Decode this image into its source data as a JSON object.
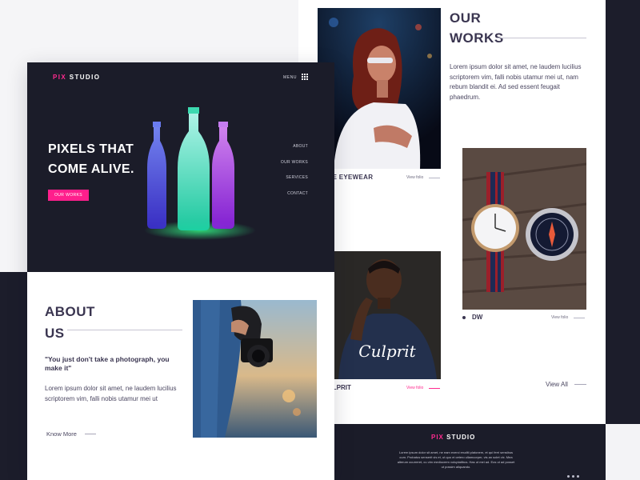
{
  "brand": {
    "accent": "#ff1f8c",
    "dark": "#1b1c29",
    "text": "#3a3550"
  },
  "left_page": {
    "logo_pix": "PIX",
    "logo_studio": "STUDIO",
    "menu_label": "MENU",
    "menu_icon": "grid-icon",
    "hero_title_line1": "PIXELS THAT",
    "hero_title_line2": "COME ALIVE.",
    "hero_button": "OUR WORKS",
    "nav": [
      "ABOUT",
      "OUR WORKS",
      "SERVICES",
      "CONTACT"
    ],
    "about": {
      "title_line1": "ABOUT",
      "title_line2": "US",
      "quote": "\"You just don't take a photograph, you make it\"",
      "body": "Lorem ipsum dolor sit amet, ne laudem lucilius scriptorem vim, falli nobis utamur mei ut",
      "link": "Know More"
    }
  },
  "right_page": {
    "works_title_line1": "OUR",
    "works_title_line2": "WORKS",
    "works_body": "Lorem ipsum dolor sit amet, ne laudem lucilius scriptorem vim, falli nobis utamur mei ut, nam rebum blandit ei. Ad sed essent feugait phaedrum.",
    "items": [
      {
        "caption": "AGE EYEWEAR",
        "link": "View folio"
      },
      {
        "caption": "DW",
        "link": "View folio"
      },
      {
        "caption": "ULPRIT",
        "link": "View folio",
        "shirt_text": "Culprit"
      }
    ],
    "view_all": "View All",
    "footer": {
      "logo_pix": "PIX",
      "logo_studio": "STUDIO",
      "text": "Lorem ipsum dolor sit amet, ne eam exerci eruditi platonem, et qui ferri sensibus cum. Probatus senserit vis et, ut quo ei cetero ullamcorper, vis an solet vix. Mea alterum ocurreret, cu vim mediocrem voluptatibus. Has ut mei ad. Eos ut ad posset ut possim aliquando."
    }
  }
}
